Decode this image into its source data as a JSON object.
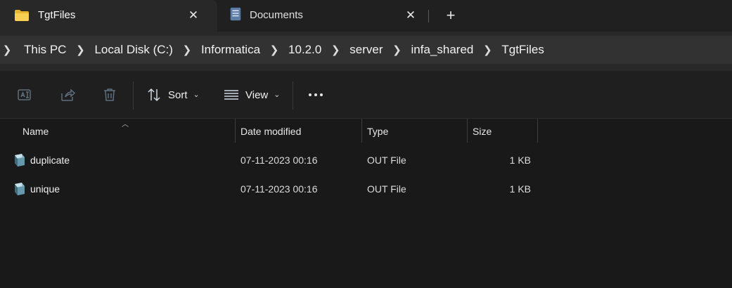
{
  "tabs": [
    {
      "title": "TgtFiles",
      "icon": "folder-icon",
      "active": true
    },
    {
      "title": "Documents",
      "icon": "document-icon",
      "active": false
    }
  ],
  "new_tab_label": "+",
  "breadcrumb": [
    "This PC",
    "Local Disk (C:)",
    "Informatica",
    "10.2.0",
    "server",
    "infa_shared",
    "TgtFiles"
  ],
  "toolbar": {
    "rename_icon": "rename-icon",
    "share_icon": "share-icon",
    "delete_icon": "trash-icon",
    "sort_label": "Sort",
    "view_label": "View"
  },
  "columns": {
    "name": "Name",
    "date": "Date modified",
    "type": "Type",
    "size": "Size"
  },
  "files": [
    {
      "name": "duplicate",
      "date": "07-11-2023 00:16",
      "type": "OUT File",
      "size": "1 KB"
    },
    {
      "name": "unique",
      "date": "07-11-2023 00:16",
      "type": "OUT File",
      "size": "1 KB"
    }
  ],
  "colors": {
    "background": "#191919",
    "tabstrip": "#202020",
    "address_field": "#323232",
    "folder_yellow": "#f2c744"
  }
}
